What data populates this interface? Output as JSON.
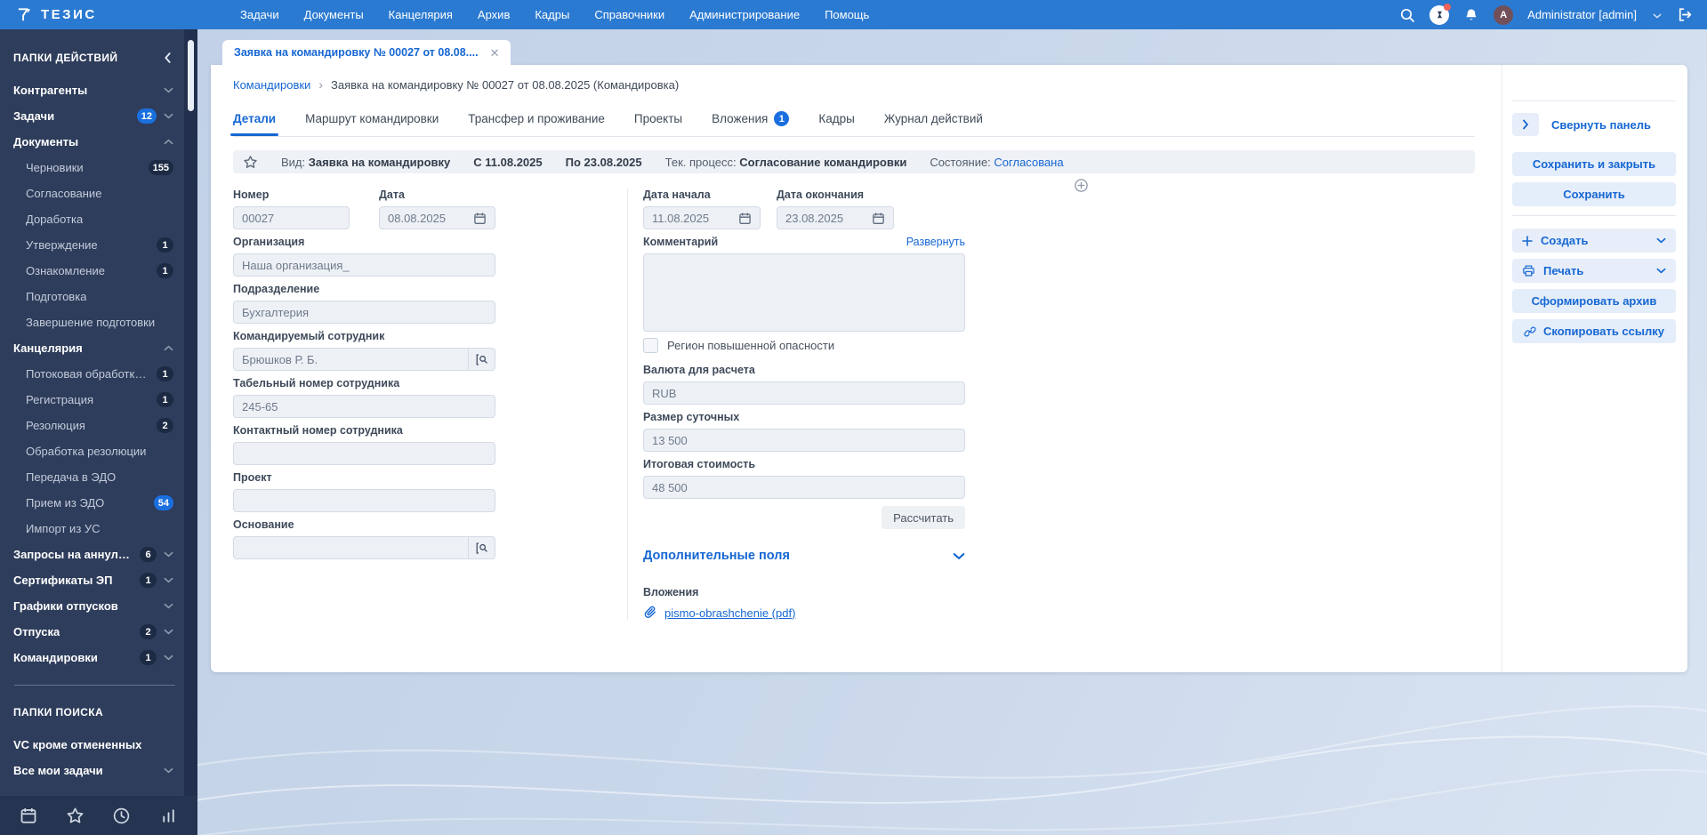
{
  "topbar": {
    "logo_text": "ТЕЗИС",
    "menu": [
      {
        "label": "Задачи"
      },
      {
        "label": "Документы"
      },
      {
        "label": "Канцелярия"
      },
      {
        "label": "Архив"
      },
      {
        "label": "Кадры"
      },
      {
        "label": "Справочники"
      },
      {
        "label": "Администрирование"
      },
      {
        "label": "Помощь"
      }
    ],
    "user": {
      "initial": "A",
      "name": "Administrator [admin]"
    }
  },
  "sidebar": {
    "actions_header": "ПАПКИ ДЕЙСТВИЙ",
    "search_header": "ПАПКИ ПОИСКА",
    "action_folders": [
      {
        "label": "Контрагенты",
        "chevron": "down",
        "group": true
      },
      {
        "label": "Задачи",
        "badge": "12",
        "badge_blue": true,
        "chevron": "down",
        "group": true
      },
      {
        "label": "Документы",
        "chevron": "up",
        "group": true
      },
      {
        "label": "Черновики",
        "badge": "155",
        "child": true
      },
      {
        "label": "Согласование",
        "child": true
      },
      {
        "label": "Доработка",
        "child": true
      },
      {
        "label": "Утверждение",
        "badge": "1",
        "child": true
      },
      {
        "label": "Ознакомление",
        "badge": "1",
        "child": true
      },
      {
        "label": "Подготовка",
        "child": true
      },
      {
        "label": "Завершение подготовки",
        "child": true
      },
      {
        "label": "Канцелярия",
        "chevron": "up",
        "group": true
      },
      {
        "label": "Потоковая обработка вхо...",
        "badge": "1",
        "child": true
      },
      {
        "label": "Регистрация",
        "badge": "1",
        "child": true
      },
      {
        "label": "Резолюция",
        "badge": "2",
        "child": true
      },
      {
        "label": "Обработка резолюции",
        "child": true
      },
      {
        "label": "Передача в ЭДО",
        "child": true
      },
      {
        "label": "Прием из ЭДО",
        "badge": "54",
        "badge_blue": true,
        "child": true
      },
      {
        "label": "Импорт из УС",
        "child": true
      },
      {
        "label": "Запросы на аннулирование",
        "badge": "6",
        "chevron": "down",
        "group": true
      },
      {
        "label": "Сертификаты ЭП",
        "badge": "1",
        "chevron": "down",
        "group": true
      },
      {
        "label": "Графики отпусков",
        "chevron": "down",
        "group": true
      },
      {
        "label": "Отпуска",
        "badge": "2",
        "chevron": "down",
        "group": true
      },
      {
        "label": "Командировки",
        "badge": "1",
        "chevron": "down",
        "group": true
      }
    ],
    "search_folders": [
      {
        "label": "VC кроме отмененных",
        "group": true
      },
      {
        "label": "Все мои задачи",
        "chevron": "down",
        "group": true
      }
    ]
  },
  "workspace": {
    "window_tab": {
      "title": "Заявка на командировку № 00027 от 08.08...."
    },
    "breadcrumb": {
      "parent": "Командировки",
      "current": "Заявка на командировку № 00027 от 08.08.2025 (Командировка)"
    },
    "doc_tabs": [
      {
        "label": "Детали",
        "active": true
      },
      {
        "label": "Маршрут командировки"
      },
      {
        "label": "Трансфер и проживание"
      },
      {
        "label": "Проекты"
      },
      {
        "label": "Вложения",
        "badge": "1"
      },
      {
        "label": "Кадры"
      },
      {
        "label": "Журнал действий"
      }
    ],
    "status_bar": {
      "kind_label": "Вид:",
      "kind": "Заявка на командировку",
      "from_label": "С",
      "from": "11.08.2025",
      "to_label": "По",
      "to": "23.08.2025",
      "process_label": "Тек. процесс:",
      "process": "Согласование командировки",
      "state_label": "Состояние:",
      "state": "Согласована"
    },
    "form": {
      "left": {
        "number": {
          "label": "Номер",
          "value": "00027"
        },
        "date": {
          "label": "Дата",
          "value": "08.08.2025"
        },
        "organization": {
          "label": "Организация",
          "value": "Наша организация_"
        },
        "department": {
          "label": "Подразделение",
          "value": "Бухгалтерия"
        },
        "employee": {
          "label": "Командируемый сотрудник",
          "value": "Брюшков Р. Б."
        },
        "personnel_number": {
          "label": "Табельный номер сотрудника",
          "value": "245-65"
        },
        "contact_number": {
          "label": "Контактный номер сотрудника",
          "value": ""
        },
        "project": {
          "label": "Проект",
          "value": ""
        },
        "basis": {
          "label": "Основание",
          "value": ""
        }
      },
      "right": {
        "start_date": {
          "label": "Дата начала",
          "value": "11.08.2025"
        },
        "end_date": {
          "label": "Дата окончания",
          "value": "23.08.2025"
        },
        "comment": {
          "label": "Комментарий",
          "value": "",
          "expand_link": "Развернуть"
        },
        "danger_region_label": "Регион повышенной опасности",
        "currency": {
          "label": "Валюта для расчета",
          "value": "RUB"
        },
        "daily_allowance": {
          "label": "Размер суточных",
          "value": "13 500"
        },
        "total_cost": {
          "label": "Итоговая стоимость",
          "value": "48 500"
        },
        "calculate_button": "Рассчитать",
        "additional_fields_link": "Дополнительные поля",
        "attachments": {
          "label": "Вложения",
          "file": "pismo-obrashchenie (pdf)"
        }
      }
    },
    "actions_panel": {
      "collapse": "Свернуть панель",
      "save_close": "Сохранить и закрыть",
      "save": "Сохранить",
      "create": "Создать",
      "print": "Печать",
      "archive": "Сформировать архив",
      "copy_link": "Скопировать ссылку"
    }
  }
}
